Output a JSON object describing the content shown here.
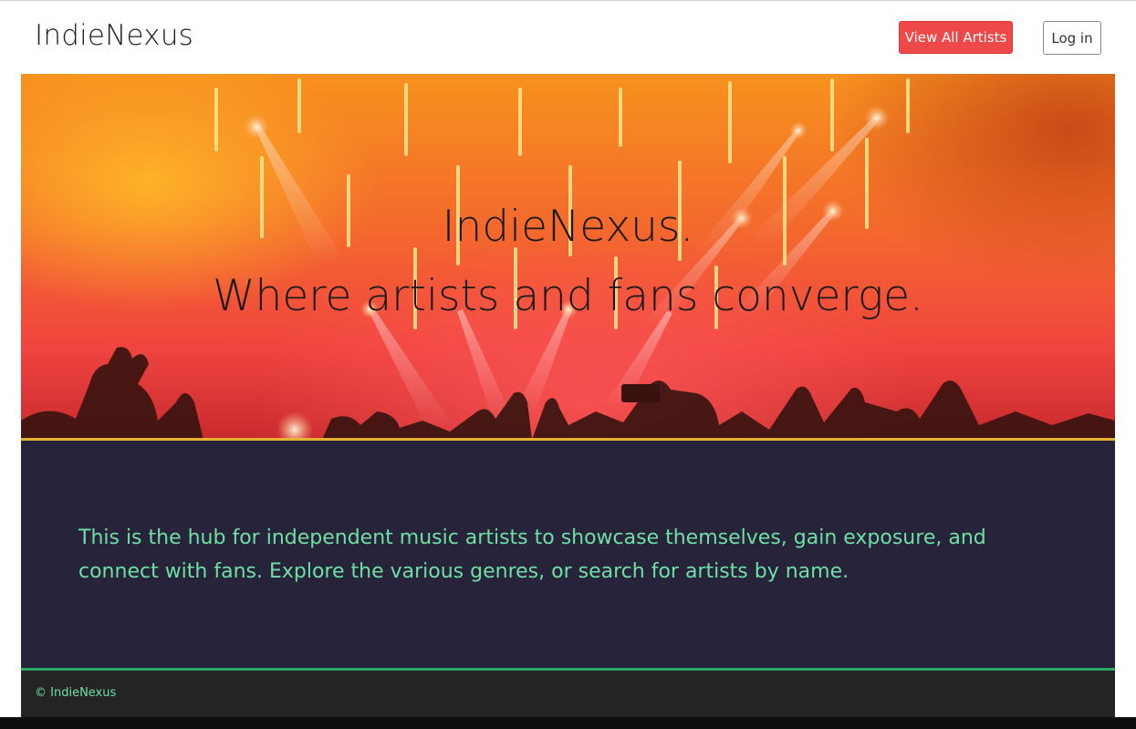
{
  "navbar": {
    "brand": "IndieNexus",
    "view_all_label": "View All Artists",
    "login_label": "Log in"
  },
  "hero": {
    "line1": "IndieNexus.",
    "line2": "Where artists and fans converge."
  },
  "intro": {
    "text": "This is the hub for independent music artists to showcase themselves, gain exposure, and connect with fans. Explore the various genres, or search for artists by name."
  },
  "footer": {
    "text": "© IndieNexus"
  },
  "colors": {
    "accent_button": "#ef4848",
    "intro_bg": "#26233a",
    "intro_text": "#6ee0a4",
    "footer_bg": "#242424",
    "footer_rule": "#2fa865",
    "hero_rule": "#e6b030"
  }
}
